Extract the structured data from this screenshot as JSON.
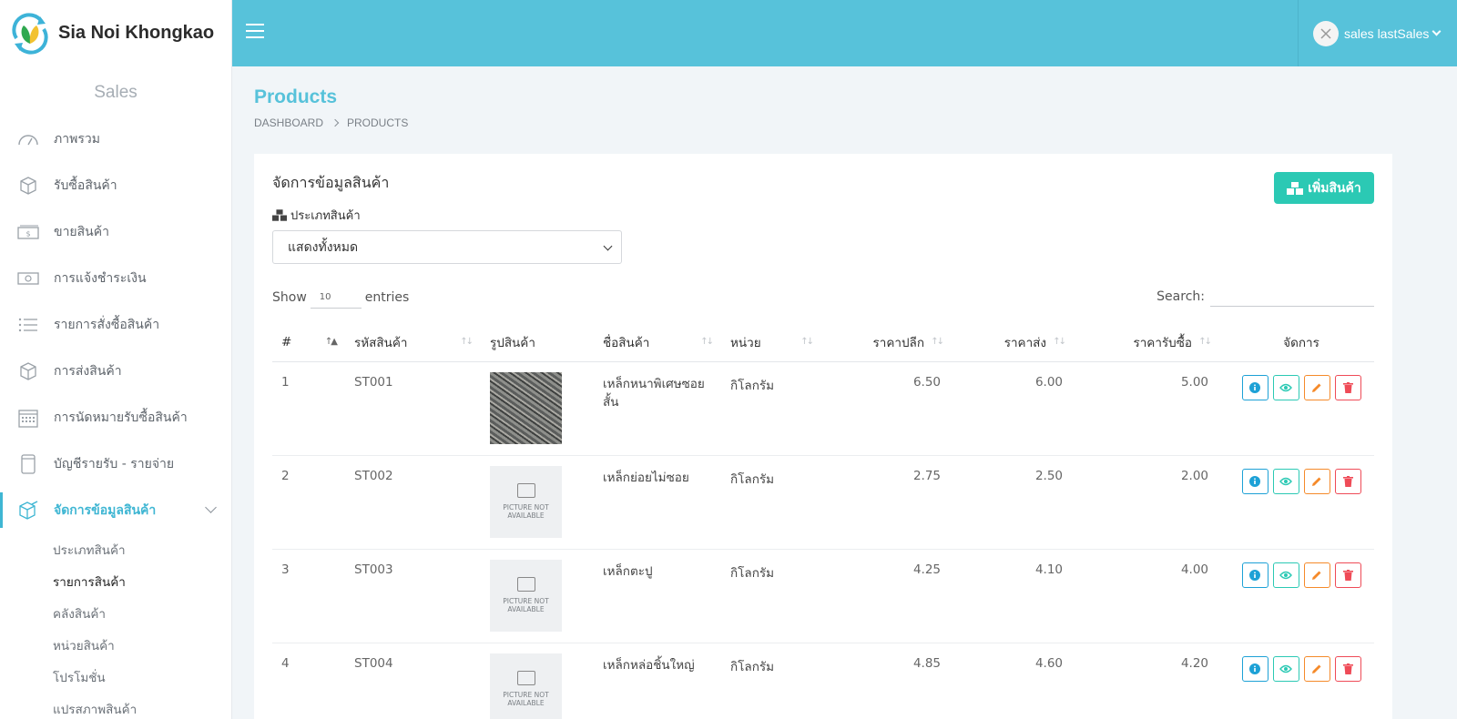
{
  "brand": {
    "name": "Sia Noi Khongkao"
  },
  "sidebar": {
    "section_title": "Sales",
    "items": [
      {
        "label": "ภาพรวม",
        "icon": "dashboard-gauge-icon"
      },
      {
        "label": "รับซื้อสินค้า",
        "icon": "box-icon"
      },
      {
        "label": "ขายสินค้า",
        "icon": "money-stack-icon"
      },
      {
        "label": "การแจ้งชำระเงิน",
        "icon": "banknote-icon"
      },
      {
        "label": "รายการสั่งซื้อสินค้า",
        "icon": "list-icon"
      },
      {
        "label": "การส่งสินค้า",
        "icon": "box-icon"
      },
      {
        "label": "การนัดหมายรับซื้อสินค้า",
        "icon": "calendar-icon"
      },
      {
        "label": "บัญชีรายรับ - รายจ่าย",
        "icon": "ledger-icon"
      },
      {
        "label": "จัดการข้อมูลสินค้า",
        "icon": "box-edit-icon",
        "active": true
      }
    ],
    "sub_items": [
      {
        "label": "ประเภทสินค้า"
      },
      {
        "label": "รายการสินค้า",
        "current": true
      },
      {
        "label": "คลังสินค้า"
      },
      {
        "label": "หน่วยสินค้า"
      },
      {
        "label": "โปรโมชั่น"
      },
      {
        "label": "แปรสภาพสินค้า"
      }
    ]
  },
  "topbar": {
    "user_name": "sales lastSales"
  },
  "page": {
    "title": "Products",
    "breadcrumb": [
      "DASHBOARD",
      "PRODUCTS"
    ]
  },
  "card": {
    "title": "จัดการข้อมูลสินค้า",
    "add_button": "เพิ่มสินค้า",
    "filter_label": "ประเภทสินค้า",
    "filter_value": "แสดงทั้งหมด",
    "show_label": "Show",
    "entries_value": "10",
    "entries_label": "entries",
    "search_label": "Search:"
  },
  "table": {
    "headers": [
      "#",
      "รหัสสินค้า",
      "รูปสินค้า",
      "ชื่อสินค้า",
      "หน่วย",
      "ราคาปลีก",
      "ราคาส่ง",
      "ราคารับซื้อ",
      "จัดการ"
    ],
    "rows": [
      {
        "no": "1",
        "code": "ST001",
        "image": "scrap",
        "name": "เหล็กหนาพิเศษซอยสั้น",
        "unit": "กิโลกรัม",
        "retail": "6.50",
        "wholesale": "6.00",
        "buy": "5.00"
      },
      {
        "no": "2",
        "code": "ST002",
        "image": "na",
        "name": "เหล็กย่อยไม่ซอย",
        "unit": "กิโลกรัม",
        "retail": "2.75",
        "wholesale": "2.50",
        "buy": "2.00"
      },
      {
        "no": "3",
        "code": "ST003",
        "image": "na",
        "name": "เหล็กตะปู",
        "unit": "กิโลกรัม",
        "retail": "4.25",
        "wholesale": "4.10",
        "buy": "4.00"
      },
      {
        "no": "4",
        "code": "ST004",
        "image": "na",
        "name": "เหล็กหล่อชิ้นใหญ่",
        "unit": "กิโลกรัม",
        "retail": "4.85",
        "wholesale": "4.60",
        "buy": "4.20"
      }
    ],
    "no_image_text": "PICTURE NOT AVAILABLE"
  },
  "colors": {
    "topbar": "#57c2da",
    "accent": "#3fb6d3",
    "add_button": "#2bc9b4",
    "info": "#1da1d6",
    "view": "#2bc9b4",
    "edit": "#f58a2a",
    "delete": "#ef4b57"
  }
}
